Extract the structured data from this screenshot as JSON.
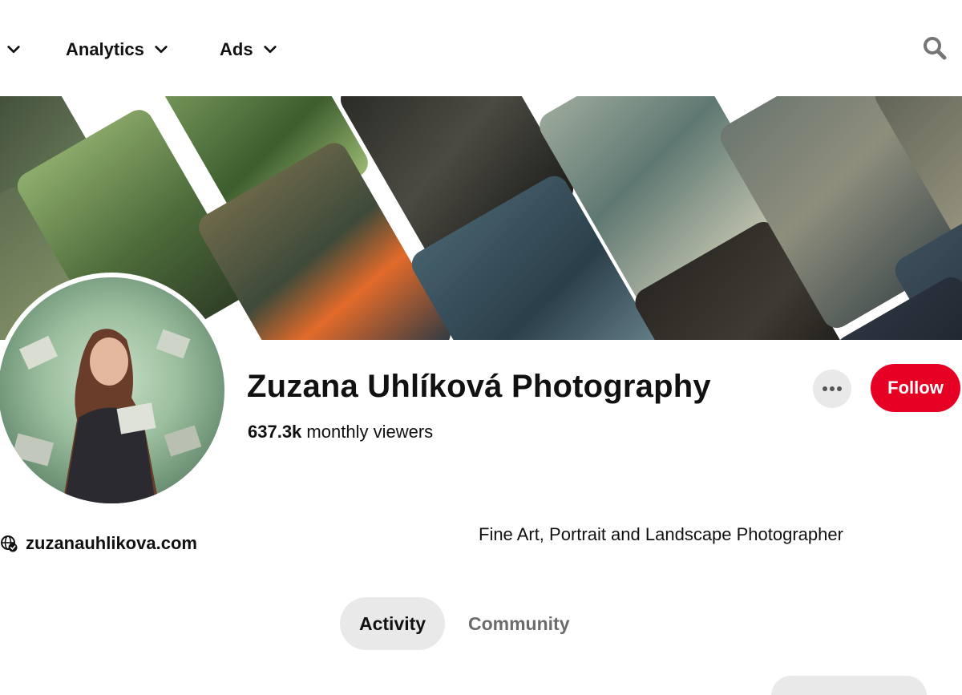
{
  "nav": {
    "items": [
      {
        "label": ""
      },
      {
        "label": "Analytics"
      },
      {
        "label": "Ads"
      }
    ]
  },
  "profile": {
    "name": "Zuzana Uhlíková Photography",
    "viewers_count": "637.3k",
    "viewers_label": "monthly viewers",
    "website": "zuzanauhlikova.com",
    "about": "Fine Art, Portrait and Landscape Photographer",
    "follow_label": "Follow"
  },
  "tabs": [
    {
      "label": "Activity",
      "selected": true
    },
    {
      "label": "Community",
      "selected": false
    }
  ],
  "bottom": {
    "heading_partial": ""
  },
  "colors": {
    "accent": "#e60023",
    "selected_tab_bg": "#e9e9e9",
    "text": "#111111",
    "muted_text": "#6b6b6b"
  },
  "icons": {
    "nav_chevron": "chevron-down-icon",
    "search": "search-icon",
    "more": "more-horizontal-icon",
    "website": "verified-globe-icon"
  }
}
